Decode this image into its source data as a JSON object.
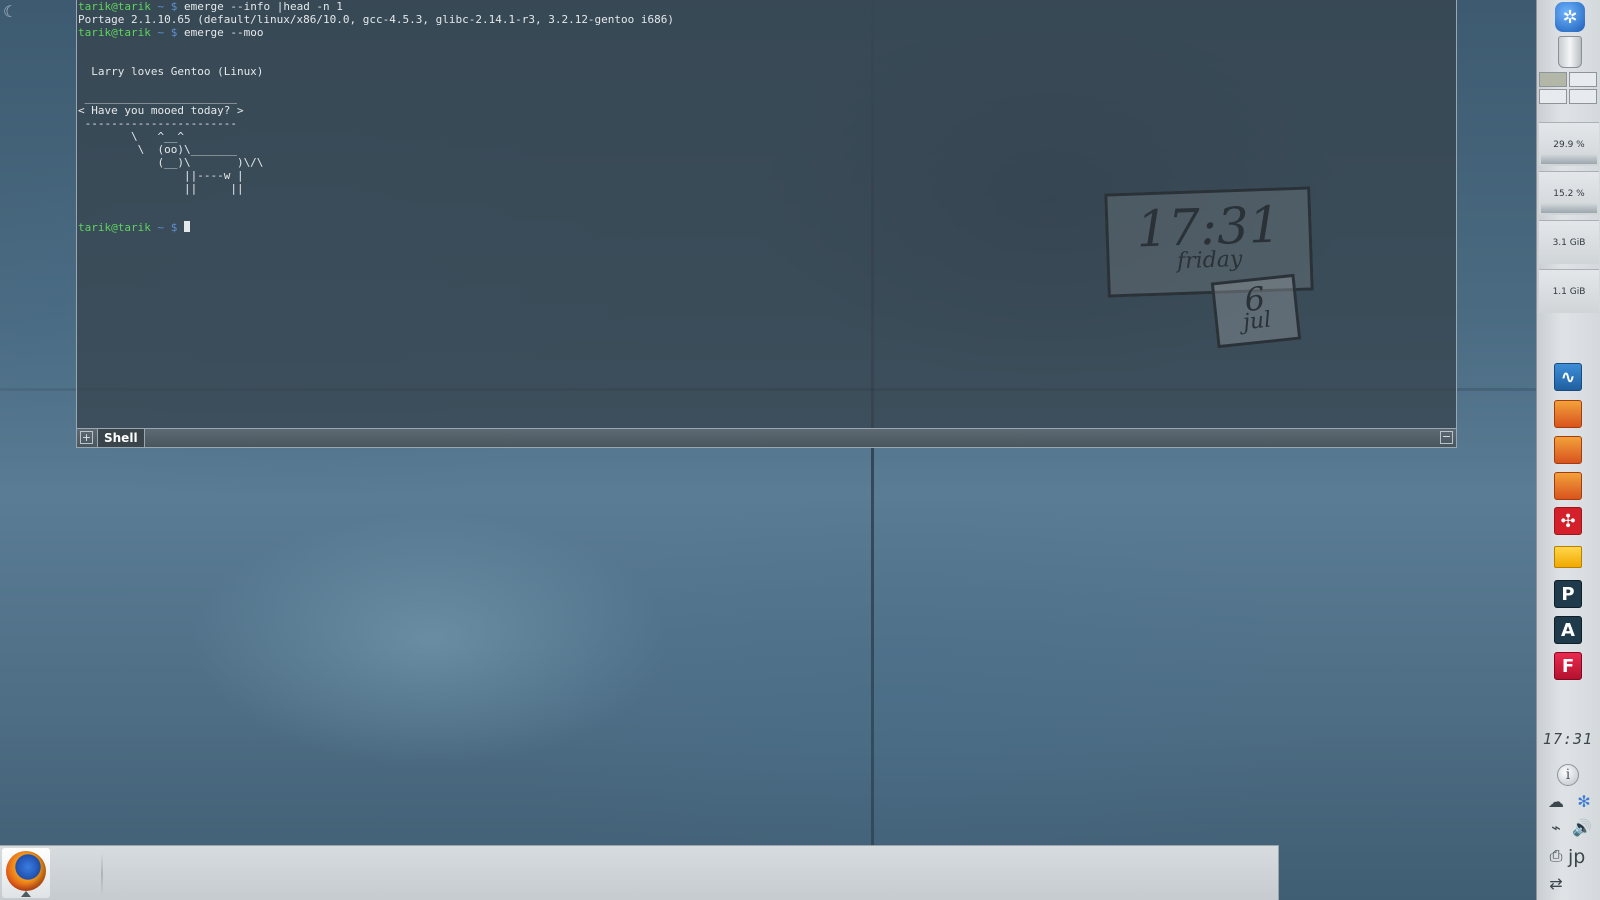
{
  "terminal": {
    "lines": [
      {
        "user": "tarik@tarik",
        "sep": " ~ $ ",
        "cmd": "emerge --info |head -n 1"
      },
      {
        "text": "Portage 2.1.10.65 (default/linux/x86/10.0, gcc-4.5.3, glibc-2.14.1-r3, 3.2.12-gentoo i686)"
      },
      {
        "user": "tarik@tarik",
        "sep": " ~ $ ",
        "cmd": "emerge --moo"
      },
      {
        "text": ""
      },
      {
        "text": ""
      },
      {
        "text": "  Larry loves Gentoo (Linux)"
      },
      {
        "text": ""
      },
      {
        "text": " _______________________"
      },
      {
        "text": "< Have you mooed today? >"
      },
      {
        "text": " -----------------------"
      },
      {
        "text": "        \\   ^__^"
      },
      {
        "text": "         \\  (oo)\\_______"
      },
      {
        "text": "            (__)\\       )\\/\\"
      },
      {
        "text": "                ||----w |"
      },
      {
        "text": "                ||     ||"
      },
      {
        "text": ""
      },
      {
        "text": ""
      }
    ],
    "prompt_user": "tarik@tarik",
    "prompt_sep": " ~ $ ",
    "tab_label": "Shell",
    "add_tab_glyph": "+",
    "close_glyph": "−"
  },
  "clock_widget": {
    "time": "17:31",
    "day": "friday",
    "date": "6",
    "month": "jul"
  },
  "panel": {
    "monitors": [
      {
        "label": "29.9 %"
      },
      {
        "label": "15.2 %"
      },
      {
        "label": "3.1 GiB"
      },
      {
        "label": "1.1 GiB"
      }
    ],
    "launchers": [
      {
        "name": "system-monitor",
        "glyph": "∿"
      },
      {
        "name": "mail-1",
        "glyph": ""
      },
      {
        "name": "mail-2",
        "glyph": ""
      },
      {
        "name": "mail-3",
        "glyph": ""
      },
      {
        "name": "mendeley",
        "glyph": "✣"
      },
      {
        "name": "folder",
        "glyph": ""
      },
      {
        "name": "p-app",
        "glyph": "P"
      },
      {
        "name": "a-app",
        "glyph": "A"
      },
      {
        "name": "f-app",
        "glyph": "F"
      }
    ],
    "clock": "17:31",
    "info_glyph": "i",
    "language": "jp",
    "colors": {
      "panel_bg": "#dfe3e6",
      "prompt_green": "#5fd35f",
      "prompt_blue": "#5f8fd3"
    }
  },
  "taskbar": {
    "launcher_icon": "firefox-icon"
  }
}
